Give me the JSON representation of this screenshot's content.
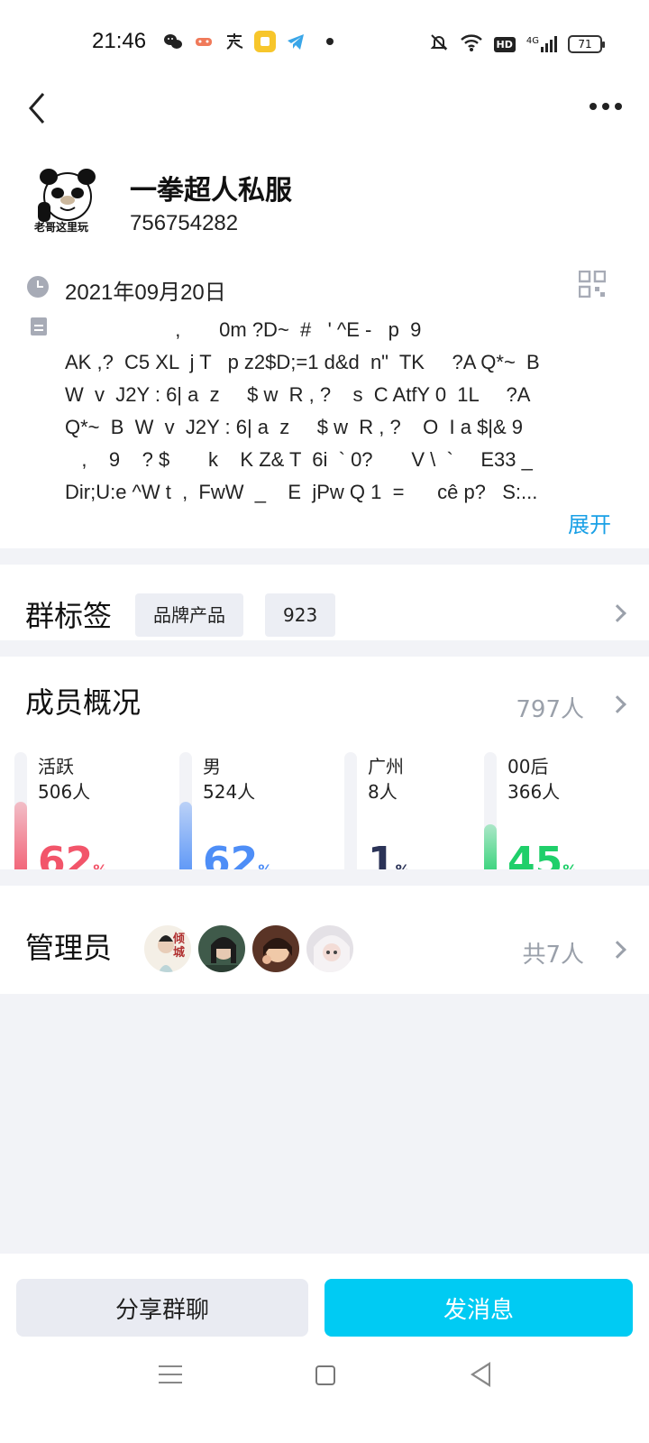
{
  "status_bar": {
    "time": "21:46",
    "left_icons": [
      "wechat-icon",
      "game-icon",
      "alipay-icon",
      "note-icon",
      "telegram-icon"
    ],
    "right_icons": [
      "mute-icon",
      "wifi-icon",
      "hd-icon",
      "signal-4g-icon"
    ],
    "hd": "HD",
    "network": "4G",
    "battery": "71"
  },
  "group": {
    "name": "一拳超人私服",
    "id": "756754282",
    "avatar_caption": "老哥这里玩",
    "created_date": "2021年09月20日",
    "description": "                    ,       0m ?D~  #   ' ^E -   p  9\nAK ,?  C5 XL  j T   p z2$D;=1 d&d  n\"  TK     ?A Q*~  B\nW  v  J2Y : 6| a  z     $ w  R , ?    s  C AtfY 0  1L     ?A\nQ*~  B  W  v  J2Y : 6| a  z     $ w  R , ?    O  I a $|& 9\n   ,    9    ? $       k    K Z& T  6i  ` 0?       V \\  `     E33 _\nDir;U:e ^W t  ,  FwW  _    E  jPw Q 1  =      cê p?   S:...",
    "expand_label": "展开"
  },
  "tags": {
    "title": "群标签",
    "items": [
      "品牌产品",
      "923"
    ]
  },
  "members": {
    "title": "成员概况",
    "count": "797人",
    "stats": [
      {
        "label": "活跃",
        "value": "506人",
        "pct": "62",
        "unit": "%",
        "fraction": 0.62,
        "color": "#f2556a"
      },
      {
        "label": "男",
        "value": "524人",
        "pct": "62",
        "unit": "%",
        "fraction": 0.62,
        "color": "#4e8ef7"
      },
      {
        "label": "广州",
        "value": "8人",
        "pct": "1",
        "unit": "%",
        "fraction": 0.01,
        "color": "#2b3357"
      },
      {
        "label": "00后",
        "value": "366人",
        "pct": "45",
        "unit": "%",
        "fraction": 0.45,
        "color": "#1fcf6a"
      }
    ]
  },
  "admins": {
    "title": "管理员",
    "count": "共7人",
    "avatar_caption": "倾城"
  },
  "actions": {
    "share": "分享群聊",
    "send": "发消息"
  },
  "colors": {
    "accent": "#00cbf3",
    "link": "#1aa0e6"
  }
}
